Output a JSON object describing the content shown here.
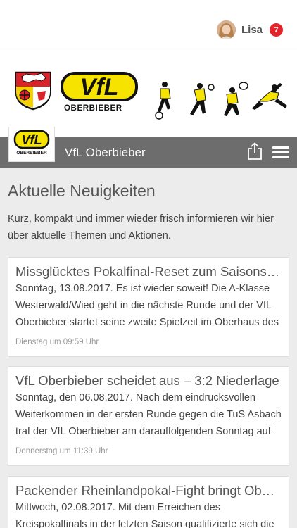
{
  "user": {
    "name": "Lisa",
    "notifications": "7"
  },
  "banner": {
    "club_name": "VfL",
    "club_location": "OBERBIEBER"
  },
  "navbar": {
    "logo_text": "VfL",
    "logo_sub": "OBERBIEBER",
    "title": "VfL Oberbieber"
  },
  "main": {
    "heading": "Aktuelle Neuigkeiten",
    "intro": "Kurz, kompakt und immer wieder frisch informieren wir hier über aktuelle Themen und Aktionen."
  },
  "news": [
    {
      "title": "Missglücktes Pokalfinal-Reset zum Saisonstart",
      "text": "Sonntag, 13.08.2017. Es ist wieder soweit! Die A-Klasse Westerwald/Wied geht in die nächste Runde und der VfL Oberbieber startet seine zweite Spielzeit im Oberhaus des",
      "date": "Dienstag um 09:59 Uhr"
    },
    {
      "title": "VfL Oberbieber scheidet aus – 3:2 Niederlage",
      "text": "Sonntag, den 06.08.2017. Nach dem eindrucksvollen Weiterkommen in der ersten Runde gegen die TuS Asbach traf der VfL Oberbieber am darauffolgenden Sonntag auf die",
      "date": "Donnerstag um 11:39 Uhr"
    },
    {
      "title": "Packender Rheinlandpokal-Fight bringt Oberbieber",
      "text": "Mittwoch, 02.08.2017. Mit dem Erreichen des Kreispokalfinals in der letzten Saison qualifizierte sich die",
      "date": ""
    }
  ],
  "colors": {
    "navbar": "#6d6d6d",
    "badge": "#e4232b",
    "logo_yellow": "#f7e300"
  },
  "icons": {
    "share": "share-icon",
    "menu": "hamburger-menu-icon"
  }
}
